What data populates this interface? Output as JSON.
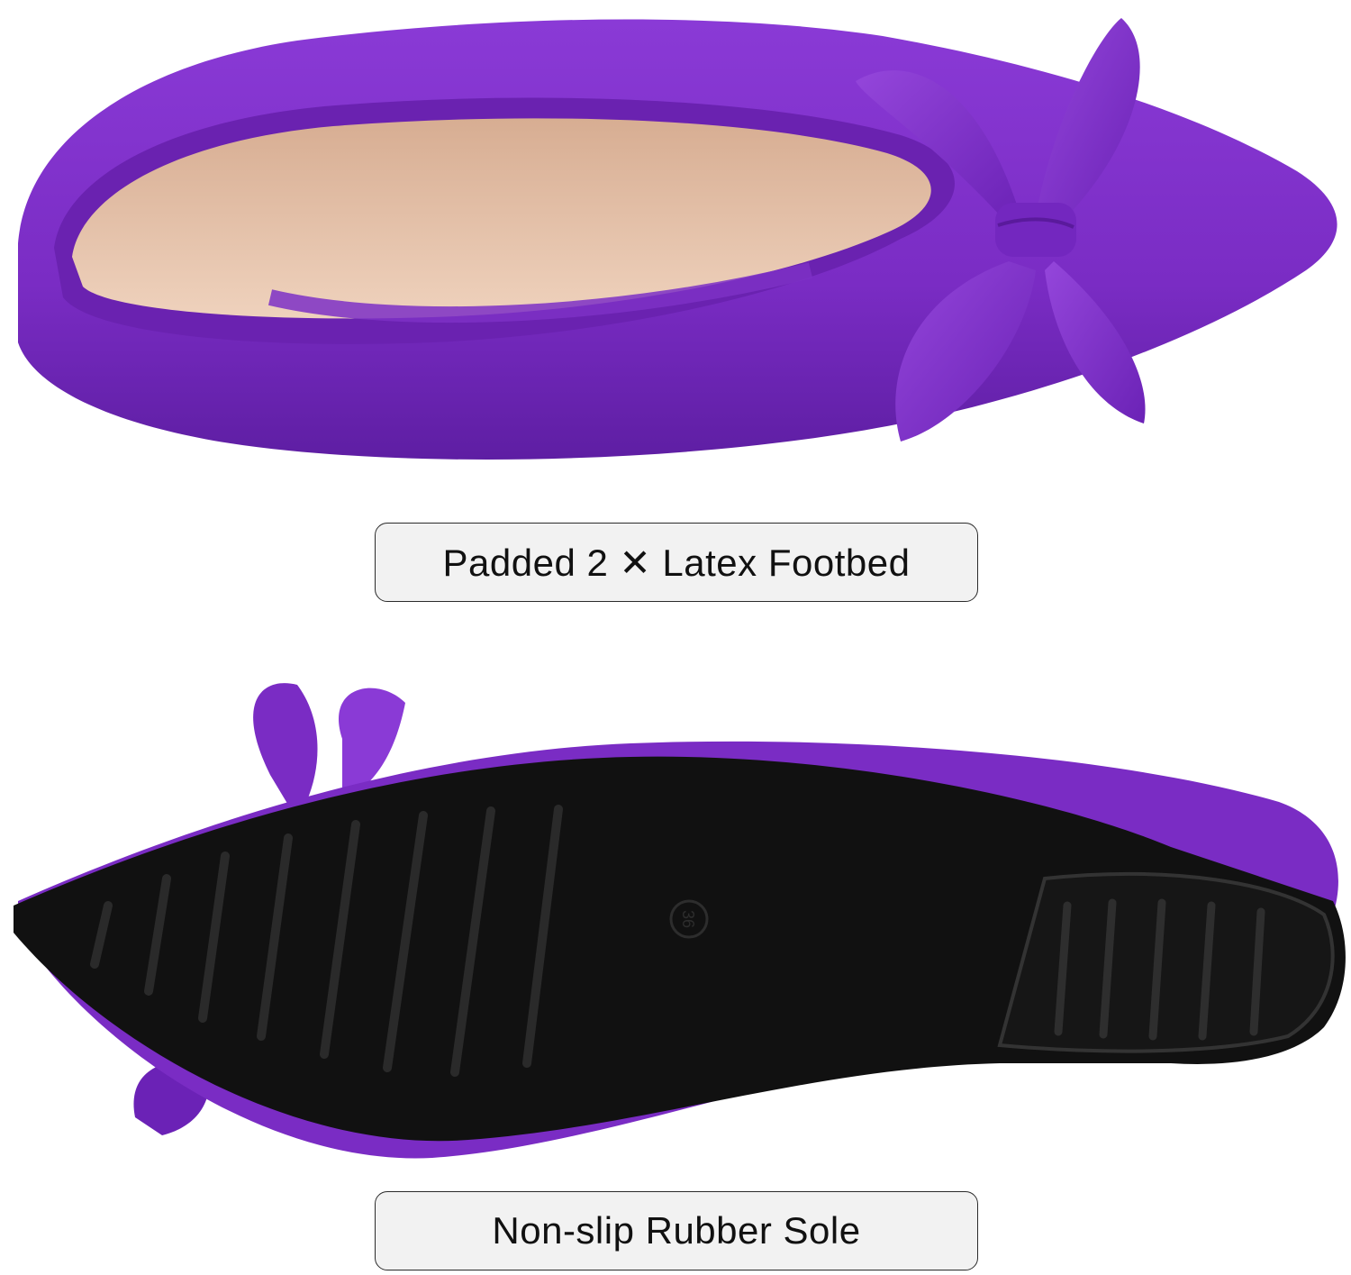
{
  "product": {
    "upper_color": "#7a2cc4",
    "lining_color": "#e8c4a8",
    "sole_color": "#111111"
  },
  "captions": {
    "footbed": "Padded 2 ✕ Latex Footbed",
    "sole": "Non-slip Rubber Sole"
  },
  "sole_marking": "36"
}
